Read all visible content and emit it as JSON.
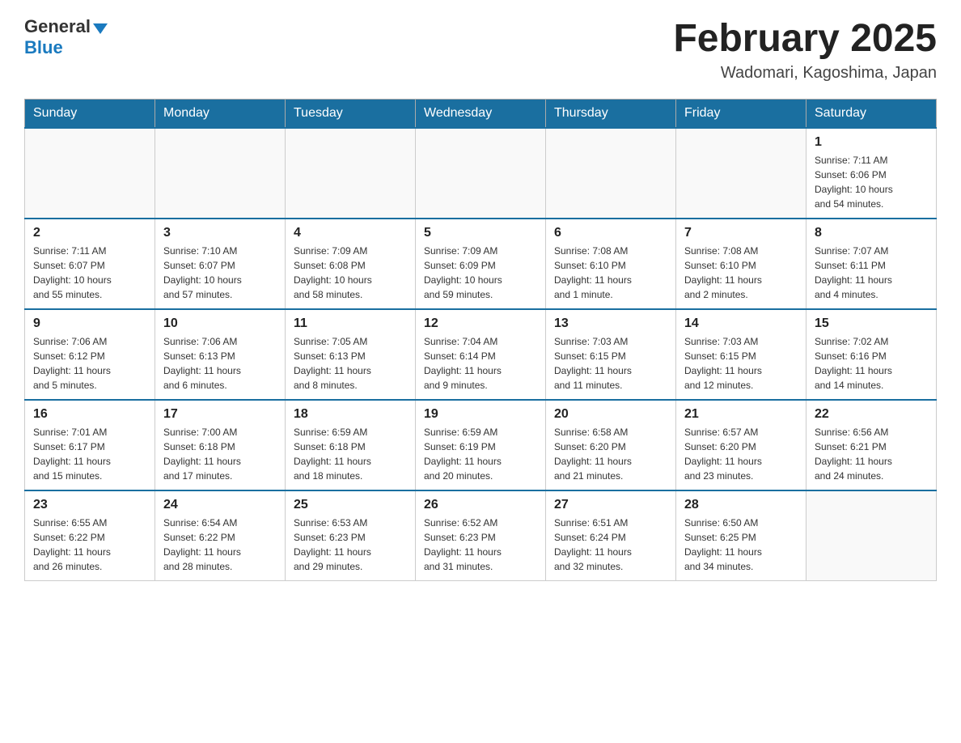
{
  "logo": {
    "general": "General",
    "blue": "Blue"
  },
  "title": "February 2025",
  "location": "Wadomari, Kagoshima, Japan",
  "weekdays": [
    "Sunday",
    "Monday",
    "Tuesday",
    "Wednesday",
    "Thursday",
    "Friday",
    "Saturday"
  ],
  "weeks": [
    {
      "days": [
        {
          "num": "",
          "info": ""
        },
        {
          "num": "",
          "info": ""
        },
        {
          "num": "",
          "info": ""
        },
        {
          "num": "",
          "info": ""
        },
        {
          "num": "",
          "info": ""
        },
        {
          "num": "",
          "info": ""
        },
        {
          "num": "1",
          "info": "Sunrise: 7:11 AM\nSunset: 6:06 PM\nDaylight: 10 hours\nand 54 minutes."
        }
      ]
    },
    {
      "days": [
        {
          "num": "2",
          "info": "Sunrise: 7:11 AM\nSunset: 6:07 PM\nDaylight: 10 hours\nand 55 minutes."
        },
        {
          "num": "3",
          "info": "Sunrise: 7:10 AM\nSunset: 6:07 PM\nDaylight: 10 hours\nand 57 minutes."
        },
        {
          "num": "4",
          "info": "Sunrise: 7:09 AM\nSunset: 6:08 PM\nDaylight: 10 hours\nand 58 minutes."
        },
        {
          "num": "5",
          "info": "Sunrise: 7:09 AM\nSunset: 6:09 PM\nDaylight: 10 hours\nand 59 minutes."
        },
        {
          "num": "6",
          "info": "Sunrise: 7:08 AM\nSunset: 6:10 PM\nDaylight: 11 hours\nand 1 minute."
        },
        {
          "num": "7",
          "info": "Sunrise: 7:08 AM\nSunset: 6:10 PM\nDaylight: 11 hours\nand 2 minutes."
        },
        {
          "num": "8",
          "info": "Sunrise: 7:07 AM\nSunset: 6:11 PM\nDaylight: 11 hours\nand 4 minutes."
        }
      ]
    },
    {
      "days": [
        {
          "num": "9",
          "info": "Sunrise: 7:06 AM\nSunset: 6:12 PM\nDaylight: 11 hours\nand 5 minutes."
        },
        {
          "num": "10",
          "info": "Sunrise: 7:06 AM\nSunset: 6:13 PM\nDaylight: 11 hours\nand 6 minutes."
        },
        {
          "num": "11",
          "info": "Sunrise: 7:05 AM\nSunset: 6:13 PM\nDaylight: 11 hours\nand 8 minutes."
        },
        {
          "num": "12",
          "info": "Sunrise: 7:04 AM\nSunset: 6:14 PM\nDaylight: 11 hours\nand 9 minutes."
        },
        {
          "num": "13",
          "info": "Sunrise: 7:03 AM\nSunset: 6:15 PM\nDaylight: 11 hours\nand 11 minutes."
        },
        {
          "num": "14",
          "info": "Sunrise: 7:03 AM\nSunset: 6:15 PM\nDaylight: 11 hours\nand 12 minutes."
        },
        {
          "num": "15",
          "info": "Sunrise: 7:02 AM\nSunset: 6:16 PM\nDaylight: 11 hours\nand 14 minutes."
        }
      ]
    },
    {
      "days": [
        {
          "num": "16",
          "info": "Sunrise: 7:01 AM\nSunset: 6:17 PM\nDaylight: 11 hours\nand 15 minutes."
        },
        {
          "num": "17",
          "info": "Sunrise: 7:00 AM\nSunset: 6:18 PM\nDaylight: 11 hours\nand 17 minutes."
        },
        {
          "num": "18",
          "info": "Sunrise: 6:59 AM\nSunset: 6:18 PM\nDaylight: 11 hours\nand 18 minutes."
        },
        {
          "num": "19",
          "info": "Sunrise: 6:59 AM\nSunset: 6:19 PM\nDaylight: 11 hours\nand 20 minutes."
        },
        {
          "num": "20",
          "info": "Sunrise: 6:58 AM\nSunset: 6:20 PM\nDaylight: 11 hours\nand 21 minutes."
        },
        {
          "num": "21",
          "info": "Sunrise: 6:57 AM\nSunset: 6:20 PM\nDaylight: 11 hours\nand 23 minutes."
        },
        {
          "num": "22",
          "info": "Sunrise: 6:56 AM\nSunset: 6:21 PM\nDaylight: 11 hours\nand 24 minutes."
        }
      ]
    },
    {
      "days": [
        {
          "num": "23",
          "info": "Sunrise: 6:55 AM\nSunset: 6:22 PM\nDaylight: 11 hours\nand 26 minutes."
        },
        {
          "num": "24",
          "info": "Sunrise: 6:54 AM\nSunset: 6:22 PM\nDaylight: 11 hours\nand 28 minutes."
        },
        {
          "num": "25",
          "info": "Sunrise: 6:53 AM\nSunset: 6:23 PM\nDaylight: 11 hours\nand 29 minutes."
        },
        {
          "num": "26",
          "info": "Sunrise: 6:52 AM\nSunset: 6:23 PM\nDaylight: 11 hours\nand 31 minutes."
        },
        {
          "num": "27",
          "info": "Sunrise: 6:51 AM\nSunset: 6:24 PM\nDaylight: 11 hours\nand 32 minutes."
        },
        {
          "num": "28",
          "info": "Sunrise: 6:50 AM\nSunset: 6:25 PM\nDaylight: 11 hours\nand 34 minutes."
        },
        {
          "num": "",
          "info": ""
        }
      ]
    }
  ]
}
